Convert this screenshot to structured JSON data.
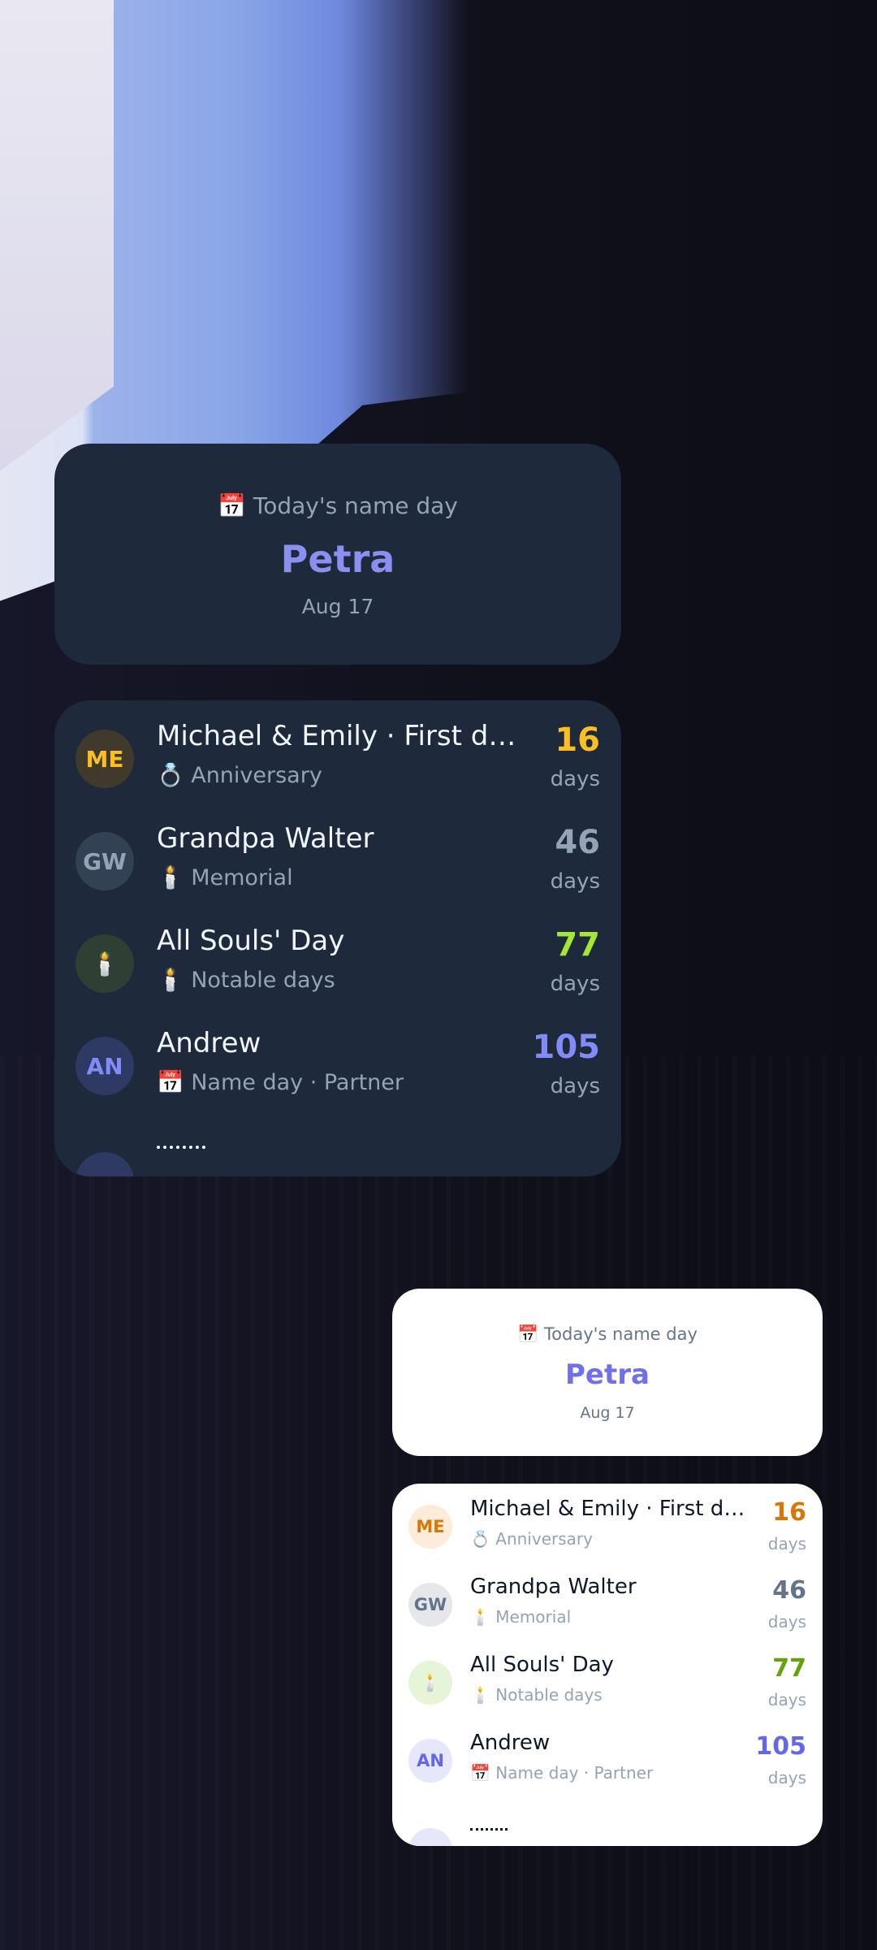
{
  "name_day_widget": {
    "icon": "📅",
    "label": "Today's name day",
    "name": "Petra",
    "date": "Aug 17"
  },
  "events": [
    {
      "initials": "ME",
      "title": "Michael & Emily · First dat…",
      "icon": "💍",
      "category": "Anniversary",
      "days": "16",
      "days_label": "days",
      "color_dark": "#fbbf24",
      "avatar_bg_dark": "#3f3a2c",
      "color_light": "#d97706",
      "avatar_bg_light": "#fdecd9"
    },
    {
      "initials": "GW",
      "title": "Grandpa Walter",
      "icon": "🕯️",
      "category": "Memorial",
      "days": "46",
      "days_label": "days",
      "color_dark": "#94a3b8",
      "avatar_bg_dark": "#334155",
      "color_light": "#64748b",
      "avatar_bg_light": "#e5e7eb"
    },
    {
      "initials": "🕯️",
      "title": "All Souls' Day",
      "icon": "🕯️",
      "category": "Notable days",
      "days": "77",
      "days_label": "days",
      "color_dark": "#a3e635",
      "avatar_bg_dark": "#2f3f34",
      "color_light": "#65a30d",
      "avatar_bg_light": "#e6f4d8"
    },
    {
      "initials": "AN",
      "title": "Andrew",
      "icon": "📅",
      "category": "Name day · Partner",
      "days": "105",
      "days_label": "days",
      "color_dark": "#818cf8",
      "avatar_bg_dark": "#2e3a63",
      "color_light": "#6366f1",
      "avatar_bg_light": "#e6e7fb"
    }
  ]
}
